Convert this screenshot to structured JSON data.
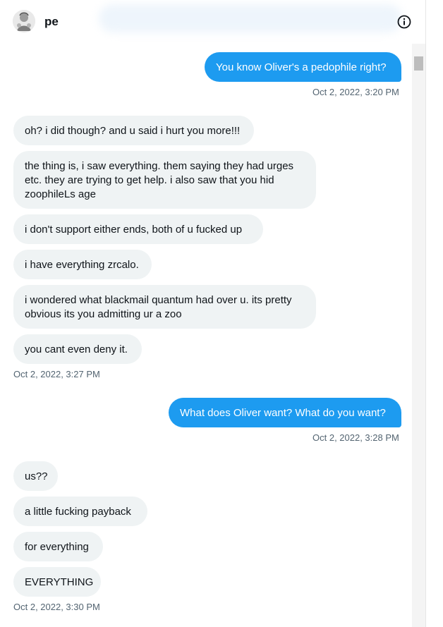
{
  "header": {
    "username": "pe"
  },
  "icons": {
    "avatar": "avatar-image",
    "info": "info-icon"
  },
  "colors": {
    "sent_bubble": "#1d9bf0",
    "received_bubble": "#eff3f4",
    "timestamp": "#536471"
  },
  "messages": [
    {
      "dir": "sent",
      "text": "You know Oliver's a pedophile right?"
    },
    {
      "dir": "sent_ts",
      "text": "Oct 2, 2022, 3:20 PM"
    },
    {
      "dir": "recv",
      "text": "oh? i did though? and u said i hurt you more!!!"
    },
    {
      "dir": "recv",
      "text": "the thing is, i saw everything. them saying they had urges etc. they are trying to get help. i also saw that you hid zoophileLs age"
    },
    {
      "dir": "recv",
      "text": "i don't support either ends, both of u fucked up"
    },
    {
      "dir": "recv",
      "text": "i have everything zrcalo."
    },
    {
      "dir": "recv",
      "text": "i wondered what blackmail quantum had over u. its pretty obvious its you admitting ur a zoo"
    },
    {
      "dir": "recv",
      "text": "you cant even deny it."
    },
    {
      "dir": "recv_ts",
      "text": "Oct 2, 2022, 3:27 PM"
    },
    {
      "dir": "sent",
      "text": "What does Oliver want? What do you want?"
    },
    {
      "dir": "sent_ts",
      "text": "Oct 2, 2022, 3:28 PM"
    },
    {
      "dir": "recv",
      "text": "us??"
    },
    {
      "dir": "recv",
      "text": "a little fucking payback"
    },
    {
      "dir": "recv",
      "text": "for everything"
    },
    {
      "dir": "recv",
      "text": "EVERYTHING"
    },
    {
      "dir": "recv_ts",
      "text": "Oct 2, 2022, 3:30 PM"
    }
  ]
}
